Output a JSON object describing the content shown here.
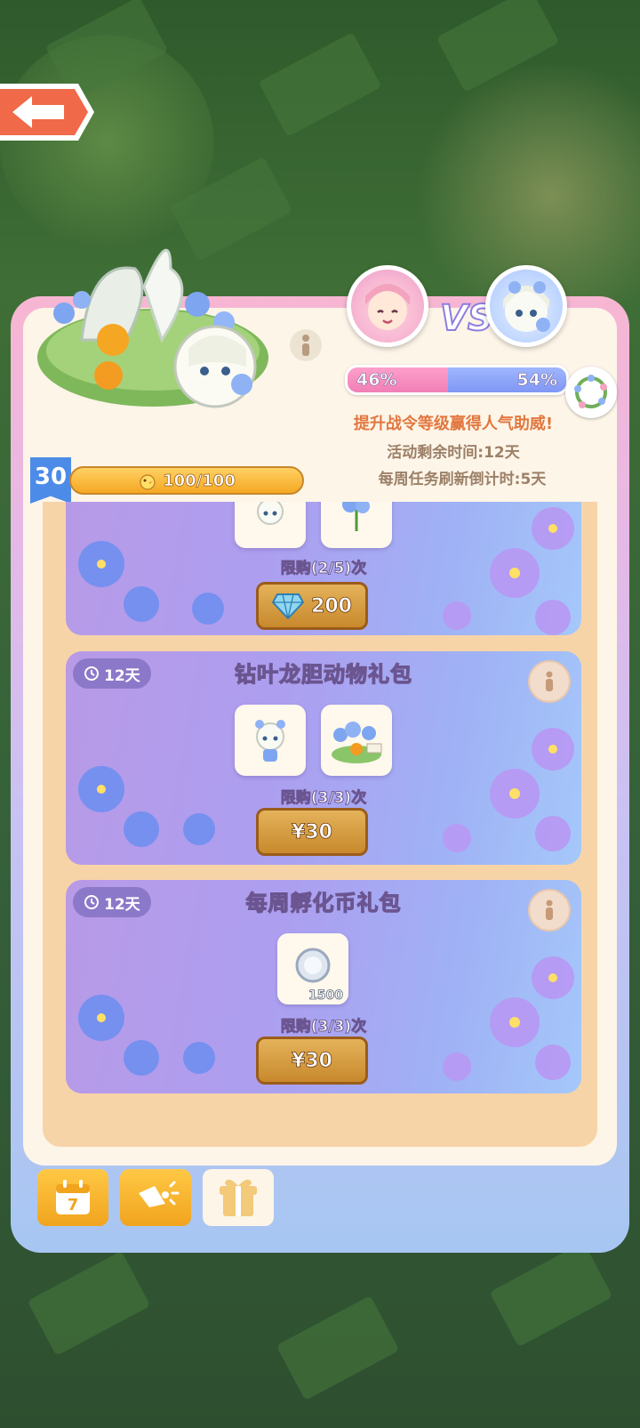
{
  "top_bar": {
    "back_icon": "arrow-left-icon"
  },
  "event": {
    "vs_text": "VS",
    "left_percent": "46%",
    "right_percent": "54%",
    "left_share": 0.46,
    "promo_text": "提升战令等级赢得人气助威!",
    "remaining_time": "活动剩余时间:12天",
    "weekly_refresh": "每周任务刷新倒计时:5天",
    "left_color": "#f07fb6",
    "right_color": "#7f97f3"
  },
  "pass": {
    "level": "30",
    "progress": "100/100"
  },
  "cards": [
    {
      "limit": "限购(2/5)次",
      "price": "200",
      "currency_icon": "diamond-icon"
    },
    {
      "timer": "12天",
      "title": "钻叶龙胆动物礼包",
      "limit": "限购(3/3)次",
      "price": "¥30"
    },
    {
      "timer": "12天",
      "title": "每周孵化币礼包",
      "limit": "限购(3/3)次",
      "price": "¥30",
      "coin_amount": "1500"
    }
  ],
  "tabs": [
    {
      "icon": "calendar-icon",
      "label": "7"
    },
    {
      "icon": "megaphone-icon"
    },
    {
      "icon": "gift-box-icon"
    }
  ]
}
